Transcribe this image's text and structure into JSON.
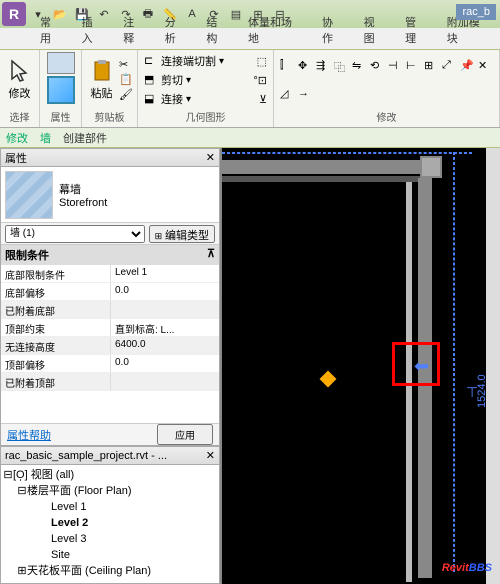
{
  "titlebar": {
    "file_label": "rac_b"
  },
  "ribbon": {
    "tabs": [
      "常用",
      "插入",
      "注释",
      "分析",
      "结构",
      "体量和场地",
      "协作",
      "视图",
      "管理",
      "附加模块"
    ],
    "groups": {
      "select": {
        "label": "选择",
        "modify": "修改"
      },
      "properties": {
        "label": "属性"
      },
      "clipboard": {
        "label": "剪贴板",
        "paste": "粘贴"
      },
      "geometry": {
        "label": "几何图形",
        "join_cut": "连接端切割",
        "cut": "剪切",
        "join": "连接"
      },
      "modify_group": {
        "label": "修改"
      }
    }
  },
  "options": {
    "modify": "修改",
    "wall": "墙",
    "create_part": "创建部件"
  },
  "properties": {
    "title": "属性",
    "type": {
      "family": "幕墙",
      "name": "Storefront"
    },
    "filter_label": "墙 (1)",
    "edit_type": "编辑类型",
    "cat_constraints": "限制条件",
    "rows": [
      {
        "label": "底部限制条件",
        "value": "Level 1"
      },
      {
        "label": "底部偏移",
        "value": "0.0"
      },
      {
        "label": "已附着底部",
        "value": ""
      },
      {
        "label": "顶部约束",
        "value": "直到标高: L..."
      },
      {
        "label": "无连接高度",
        "value": "6400.0"
      },
      {
        "label": "顶部偏移",
        "value": "0.0"
      },
      {
        "label": "已附着顶部",
        "value": ""
      }
    ],
    "help": "属性帮助",
    "apply": "应用"
  },
  "browser": {
    "title": "rac_basic_sample_project.rvt - ...",
    "root": "视图 (all)",
    "floor_plans": "楼层平面 (Floor Plan)",
    "levels": [
      "Level 1",
      "Level 2",
      "Level 3",
      "Site"
    ],
    "ceiling_plans": "天花板平面 (Ceiling Plan)"
  },
  "canvas": {
    "dimension": "1524.0"
  },
  "watermark": {
    "part1": "Revit",
    "part2": "BBS"
  }
}
